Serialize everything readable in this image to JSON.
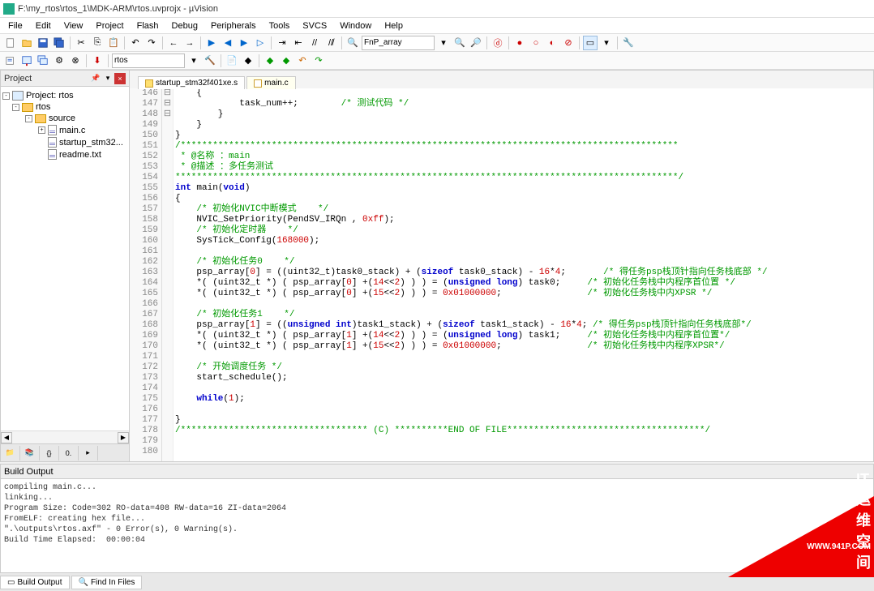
{
  "window": {
    "title": "F:\\my_rtos\\rtos_1\\MDK-ARM\\rtos.uvprojx - µVision"
  },
  "menu": {
    "items": [
      "File",
      "Edit",
      "View",
      "Project",
      "Flash",
      "Debug",
      "Peripherals",
      "Tools",
      "SVCS",
      "Window",
      "Help"
    ]
  },
  "toolbar2_combo": "rtos",
  "project": {
    "panel_title": "Project",
    "root": "Project: rtos",
    "target": "rtos",
    "group": "source",
    "files": [
      "main.c",
      "startup_stm32...",
      "readme.txt"
    ]
  },
  "editor": {
    "tabs": [
      "startup_stm32f401xe.s",
      "main.c"
    ],
    "active_tab": 1,
    "lines": [
      {
        "n": 146,
        "fold": "⊟",
        "html": "    {"
      },
      {
        "n": 147,
        "html": "            task_num++;        <span class='c-com'>/* 测试代码 */</span>"
      },
      {
        "n": 148,
        "html": "        }"
      },
      {
        "n": 149,
        "html": "    }"
      },
      {
        "n": 150,
        "html": "}"
      },
      {
        "n": 151,
        "fold": "⊟",
        "html": "<span class='c-com'>/*********************************************************************************************</span>"
      },
      {
        "n": 152,
        "html": "<span class='c-com'> * @名称 ：main</span>"
      },
      {
        "n": 153,
        "html": "<span class='c-com'> * @描述 ：多任务测试</span>"
      },
      {
        "n": 154,
        "html": "<span class='c-com'>**********************************************************************************************/</span>"
      },
      {
        "n": 155,
        "html": "<span class='c-kw'>int</span> main(<span class='c-kw'>void</span>)"
      },
      {
        "n": 156,
        "fold": "⊟",
        "html": "{"
      },
      {
        "n": 157,
        "html": "    <span class='c-com'>/* 初始化NVIC中断模式    */</span>"
      },
      {
        "n": 158,
        "html": "    NVIC_SetPriority(PendSV_IRQn , <span class='c-num'>0xff</span>);"
      },
      {
        "n": 159,
        "html": "    <span class='c-com'>/* 初始化定时器    */</span>"
      },
      {
        "n": 160,
        "html": "    SysTick_Config(<span class='c-num'>168000</span>);"
      },
      {
        "n": 161,
        "html": ""
      },
      {
        "n": 162,
        "html": "    <span class='c-com'>/* 初始化任务0    */</span>"
      },
      {
        "n": 163,
        "html": "    psp_array[<span class='c-num'>0</span>] = ((uint32_t)task0_stack) + (<span class='c-kw'>sizeof</span> task0_stack) - <span class='c-num'>16</span>*<span class='c-num'>4</span>;       <span class='c-com'>/* 得任务psp栈顶针指向任务栈底部 */</span>"
      },
      {
        "n": 164,
        "html": "    *( (uint32_t *) ( psp_array[<span class='c-num'>0</span>] +(<span class='c-num'>14</span>&lt;&lt;<span class='c-num'>2</span>) ) ) = (<span class='c-kw'>unsigned long</span>) task0;     <span class='c-com'>/* 初始化任务栈中内程序首位置 */</span>"
      },
      {
        "n": 165,
        "html": "    *( (uint32_t *) ( psp_array[<span class='c-num'>0</span>] +(<span class='c-num'>15</span>&lt;&lt;<span class='c-num'>2</span>) ) ) = <span class='c-num'>0x01000000</span>;                <span class='c-com'>/* 初始化任务栈中内XPSR */</span>"
      },
      {
        "n": 166,
        "html": ""
      },
      {
        "n": 167,
        "html": "    <span class='c-com'>/* 初始化任务1    */</span>"
      },
      {
        "n": 168,
        "html": "    psp_array[<span class='c-num'>1</span>] = ((<span class='c-kw'>unsigned int</span>)task1_stack) + (<span class='c-kw'>sizeof</span> task1_stack) - <span class='c-num'>16</span>*<span class='c-num'>4</span>; <span class='c-com'>/* 得任务psp栈顶针指向任务栈底部*/</span>"
      },
      {
        "n": 169,
        "html": "    *( (uint32_t *) ( psp_array[<span class='c-num'>1</span>] +(<span class='c-num'>14</span>&lt;&lt;<span class='c-num'>2</span>) ) ) = (<span class='c-kw'>unsigned long</span>) task1;     <span class='c-com'>/* 初始化任务栈中内程序首位置*/</span>"
      },
      {
        "n": 170,
        "html": "    *( (uint32_t *) ( psp_array[<span class='c-num'>1</span>] +(<span class='c-num'>15</span>&lt;&lt;<span class='c-num'>2</span>) ) ) = <span class='c-num'>0x01000000</span>;                <span class='c-com'>/* 初始化任务栈中内程序XPSR*/</span>"
      },
      {
        "n": 171,
        "html": ""
      },
      {
        "n": 172,
        "html": "    <span class='c-com'>/* 开始调度任务 */</span>"
      },
      {
        "n": 173,
        "html": "    start_schedule();"
      },
      {
        "n": 174,
        "html": ""
      },
      {
        "n": 175,
        "html": "    <span class='c-kw'>while</span>(<span class='c-num'>1</span>);"
      },
      {
        "n": 176,
        "html": ""
      },
      {
        "n": 177,
        "html": "}"
      },
      {
        "n": 178,
        "html": "<span class='c-com'>/*********************************** (C) **********END OF FILE*************************************/</span>"
      },
      {
        "n": 179,
        "html": ""
      },
      {
        "n": 180,
        "html": ""
      }
    ]
  },
  "build": {
    "title": "Build Output",
    "lines": [
      "compiling main.c...",
      "linking...",
      "Program Size: Code=302 RO-data=408 RW-data=16 ZI-data=2064",
      "FromELF: creating hex file...",
      "\".\\outputs\\rtos.axf\" - 0 Error(s), 0 Warning(s).",
      "Build Time Elapsed:  00:00:04"
    ]
  },
  "bottom_tabs": [
    "Build Output",
    "Find In Files"
  ],
  "FnP_combo": "FnP_array",
  "watermark": {
    "line1": "WWW.941P.COM",
    "line2": "IT运维空间"
  }
}
